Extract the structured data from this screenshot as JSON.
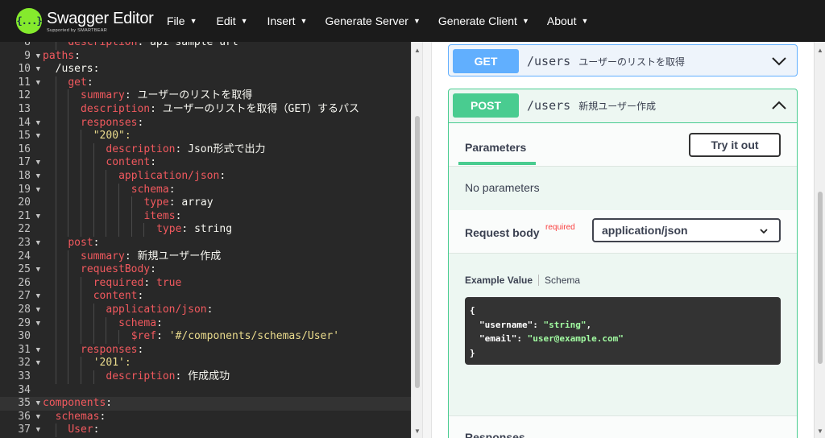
{
  "app": {
    "name": "Swagger Editor",
    "sub": "Supported by SMARTBEAR",
    "logo_glyph": "{...}"
  },
  "menu": [
    {
      "label": "File"
    },
    {
      "label": "Edit"
    },
    {
      "label": "Insert"
    },
    {
      "label": "Generate Server"
    },
    {
      "label": "Generate Client"
    },
    {
      "label": "About"
    }
  ],
  "editor": {
    "lines": [
      {
        "n": "8",
        "fold": "",
        "indent": 2,
        "key": "description",
        "val": "api sample url",
        "vtype": "c"
      },
      {
        "n": "9",
        "fold": "▼",
        "indent": 0,
        "key": "paths",
        "val": "",
        "vtype": ""
      },
      {
        "n": "10",
        "fold": "▼",
        "indent": 1,
        "key": "",
        "val": "/users:",
        "vtype": "c"
      },
      {
        "n": "11",
        "fold": "▼",
        "indent": 2,
        "key": "get",
        "val": "",
        "vtype": ""
      },
      {
        "n": "12",
        "fold": "",
        "indent": 3,
        "key": "summary",
        "val": "ユーザーのリストを取得",
        "vtype": "c"
      },
      {
        "n": "13",
        "fold": "",
        "indent": 3,
        "key": "description",
        "val": "ユーザーのリストを取得（GET）するパス",
        "vtype": "c"
      },
      {
        "n": "14",
        "fold": "▼",
        "indent": 3,
        "key": "responses",
        "val": "",
        "vtype": ""
      },
      {
        "n": "15",
        "fold": "▼",
        "indent": 4,
        "key": "",
        "val": "\"200\":",
        "vtype": "s"
      },
      {
        "n": "16",
        "fold": "",
        "indent": 5,
        "key": "description",
        "val": "Json形式で出力",
        "vtype": "c"
      },
      {
        "n": "17",
        "fold": "▼",
        "indent": 5,
        "key": "content",
        "val": "",
        "vtype": ""
      },
      {
        "n": "18",
        "fold": "▼",
        "indent": 6,
        "key": "application/json",
        "val": "",
        "vtype": ""
      },
      {
        "n": "19",
        "fold": "▼",
        "indent": 7,
        "key": "schema",
        "val": "",
        "vtype": ""
      },
      {
        "n": "20",
        "fold": "",
        "indent": 8,
        "key": "type",
        "val": "array",
        "vtype": "c"
      },
      {
        "n": "21",
        "fold": "▼",
        "indent": 8,
        "key": "items",
        "val": "",
        "vtype": ""
      },
      {
        "n": "22",
        "fold": "",
        "indent": 9,
        "key": "type",
        "val": "string",
        "vtype": "c"
      },
      {
        "n": "23",
        "fold": "▼",
        "indent": 2,
        "key": "post",
        "val": "",
        "vtype": ""
      },
      {
        "n": "24",
        "fold": "",
        "indent": 3,
        "key": "summary",
        "val": "新規ユーザー作成",
        "vtype": "c"
      },
      {
        "n": "25",
        "fold": "▼",
        "indent": 3,
        "key": "requestBody",
        "val": "",
        "vtype": ""
      },
      {
        "n": "26",
        "fold": "",
        "indent": 4,
        "key": "required",
        "val": "true",
        "vtype": "k"
      },
      {
        "n": "27",
        "fold": "▼",
        "indent": 4,
        "key": "content",
        "val": "",
        "vtype": ""
      },
      {
        "n": "28",
        "fold": "▼",
        "indent": 5,
        "key": "application/json",
        "val": "",
        "vtype": ""
      },
      {
        "n": "29",
        "fold": "▼",
        "indent": 6,
        "key": "schema",
        "val": "",
        "vtype": ""
      },
      {
        "n": "30",
        "fold": "",
        "indent": 7,
        "key": "$ref",
        "val": "'#/components/schemas/User'",
        "vtype": "s"
      },
      {
        "n": "31",
        "fold": "▼",
        "indent": 3,
        "key": "responses",
        "val": "",
        "vtype": ""
      },
      {
        "n": "32",
        "fold": "▼",
        "indent": 4,
        "key": "",
        "val": "'201':",
        "vtype": "s"
      },
      {
        "n": "33",
        "fold": "",
        "indent": 5,
        "key": "description",
        "val": "作成成功",
        "vtype": "c"
      },
      {
        "n": "34",
        "fold": "",
        "indent": 0,
        "key": "",
        "val": "",
        "vtype": ""
      },
      {
        "n": "35",
        "fold": "▼",
        "indent": 0,
        "key": "components",
        "val": "",
        "vtype": "",
        "active": true
      },
      {
        "n": "36",
        "fold": "▼",
        "indent": 1,
        "key": "schemas",
        "val": "",
        "vtype": ""
      },
      {
        "n": "37",
        "fold": "▼",
        "indent": 2,
        "key": "User",
        "val": "",
        "vtype": ""
      }
    ]
  },
  "preview": {
    "get_op": {
      "method": "GET",
      "path": "/users",
      "summary": "ユーザーのリストを取得"
    },
    "post_op": {
      "method": "POST",
      "path": "/users",
      "summary": "新規ユーザー作成"
    },
    "params_tab": "Parameters",
    "try_it_out": "Try it out",
    "no_params": "No parameters",
    "request_body": "Request body",
    "required": "required",
    "content_type": "application/json",
    "example_value_tab": "Example Value",
    "schema_tab": "Schema",
    "example_json": {
      "open": "{",
      "rows": [
        {
          "k": "\"username\"",
          "v": "\"string\"",
          "sep": ","
        },
        {
          "k": "\"email\"",
          "v": "\"user@example.com\"",
          "sep": ""
        }
      ],
      "close": "}"
    },
    "responses_title": "Responses"
  },
  "colors": {
    "get": "#61affe",
    "post": "#49cc90",
    "key": "#f1595e",
    "string": "#ebdc8d",
    "logo": "#85ea2d"
  }
}
